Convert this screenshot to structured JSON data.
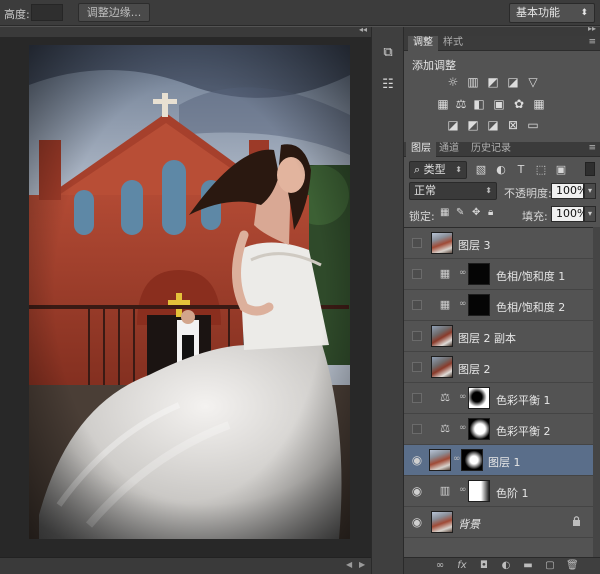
{
  "options_bar": {
    "height_label": "高度:",
    "refine_edge_button": "调整边缘...",
    "workspace": "基本功能"
  },
  "adjustments_panel": {
    "tabs": [
      "调整",
      "样式"
    ],
    "title": "添加调整",
    "icons_row1": [
      "brightness-contrast-icon",
      "levels-icon",
      "curves-icon",
      "exposure-icon",
      "vibrance-icon"
    ],
    "icons_row2": [
      "hue-saturation-icon",
      "color-balance-icon",
      "black-white-icon",
      "photo-filter-icon",
      "channel-mixer-icon",
      "color-lookup-icon"
    ],
    "icons_row3": [
      "invert-icon",
      "posterize-icon",
      "threshold-icon",
      "selective-color-icon",
      "gradient-map-icon"
    ]
  },
  "layers_panel": {
    "tabs": [
      "图层",
      "通道",
      "历史记录"
    ],
    "filter_kind": "类型",
    "blend_mode": "正常",
    "opacity_label": "不透明度:",
    "opacity_value": "100%",
    "lock_label": "锁定:",
    "fill_label": "填充:",
    "fill_value": "100%",
    "layers": [
      {
        "name": "图层 3",
        "visible": false,
        "kind": "pixel",
        "selected": false
      },
      {
        "name": "色相/饱和度 1",
        "visible": false,
        "kind": "hue-saturation",
        "selected": false
      },
      {
        "name": "色相/饱和度 2",
        "visible": false,
        "kind": "hue-saturation",
        "selected": false
      },
      {
        "name": "图层 2 副本",
        "visible": false,
        "kind": "pixel",
        "selected": false
      },
      {
        "name": "图层 2",
        "visible": false,
        "kind": "pixel",
        "selected": false
      },
      {
        "name": "色彩平衡 1",
        "visible": false,
        "kind": "color-balance",
        "selected": false
      },
      {
        "name": "色彩平衡 2",
        "visible": false,
        "kind": "color-balance",
        "selected": false
      },
      {
        "name": "图层 1",
        "visible": true,
        "kind": "pixel-masked",
        "selected": true
      },
      {
        "name": "色阶 1",
        "visible": true,
        "kind": "levels",
        "selected": false
      },
      {
        "name": "背景",
        "visible": true,
        "kind": "background",
        "selected": false
      }
    ]
  },
  "colors": {
    "selected_row": "#5a6e8a",
    "canvas_bg": "#282828",
    "panel_bg": "#535353"
  }
}
